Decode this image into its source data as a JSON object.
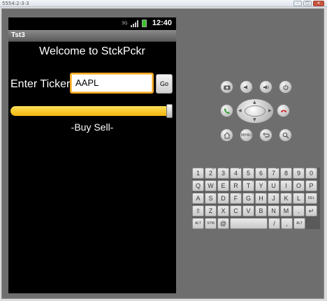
{
  "window": {
    "title": "5554:2-3-3"
  },
  "statusbar": {
    "network": "3G",
    "time": "12:40"
  },
  "app": {
    "title": "Tst3",
    "welcome": "Welcome to StckPckr",
    "ticker_label": "Enter Ticker",
    "ticker_value": "AAPL",
    "go_label": "Go",
    "slider_percent": 100,
    "buy_sell_label": "-Buy    Sell-"
  },
  "keyboard": {
    "row1": [
      {
        "k": "1",
        "s": "!"
      },
      {
        "k": "2",
        "s": "@"
      },
      {
        "k": "3",
        "s": "#"
      },
      {
        "k": "4",
        "s": "$"
      },
      {
        "k": "5",
        "s": "%"
      },
      {
        "k": "6",
        "s": "^"
      },
      {
        "k": "7",
        "s": "&"
      },
      {
        "k": "8",
        "s": "*"
      },
      {
        "k": "9",
        "s": "("
      },
      {
        "k": "0",
        "s": ")"
      }
    ],
    "row2": [
      {
        "k": "Q",
        "s": ""
      },
      {
        "k": "W",
        "s": "~"
      },
      {
        "k": "E",
        "s": "\""
      },
      {
        "k": "R",
        "s": ""
      },
      {
        "k": "T",
        "s": "{"
      },
      {
        "k": "Y",
        "s": "}"
      },
      {
        "k": "U",
        "s": "-"
      },
      {
        "k": "I",
        "s": ""
      },
      {
        "k": "O",
        "s": "+"
      },
      {
        "k": "P",
        "s": "="
      }
    ],
    "row3": [
      {
        "k": "A",
        "s": ""
      },
      {
        "k": "S",
        "s": "\\"
      },
      {
        "k": "D",
        "s": ""
      },
      {
        "k": "F",
        "s": "["
      },
      {
        "k": "G",
        "s": "]"
      },
      {
        "k": "H",
        "s": "<"
      },
      {
        "k": "J",
        "s": ">"
      },
      {
        "k": "K",
        "s": ";"
      },
      {
        "k": "L",
        "s": ":"
      },
      {
        "k": "DEL",
        "s": ""
      }
    ],
    "row4": [
      {
        "k": "⇧",
        "s": ""
      },
      {
        "k": "Z",
        "s": ""
      },
      {
        "k": "X",
        "s": ""
      },
      {
        "k": "C",
        "s": ""
      },
      {
        "k": "V",
        "s": ""
      },
      {
        "k": "B",
        "s": ""
      },
      {
        "k": "N",
        "s": ""
      },
      {
        "k": "M",
        "s": ""
      },
      {
        "k": ".",
        "s": ""
      },
      {
        "k": "↵",
        "s": ""
      }
    ],
    "row5": [
      {
        "k": "ALT",
        "s": ""
      },
      {
        "k": "SYM",
        "s": ""
      },
      {
        "k": "@",
        "s": ""
      },
      {
        "k": "",
        "s": ""
      },
      {
        "k": "/",
        "s": "?"
      },
      {
        "k": ",",
        "s": ""
      },
      {
        "k": "ALT",
        "s": ""
      }
    ]
  },
  "controls": {
    "row1_icons": [
      "camera-icon",
      "volume-down-icon",
      "volume-up-icon",
      "power-icon"
    ],
    "row2_icons": [
      "call-icon",
      "dpad",
      "end-call-icon"
    ],
    "row3_icons": [
      "home-icon",
      "menu-icon",
      "back-icon",
      "search-icon"
    ],
    "menu_label": "MENU"
  },
  "colors": {
    "input_focus": "#f5a623",
    "slider_fill": "#f3c21d"
  }
}
